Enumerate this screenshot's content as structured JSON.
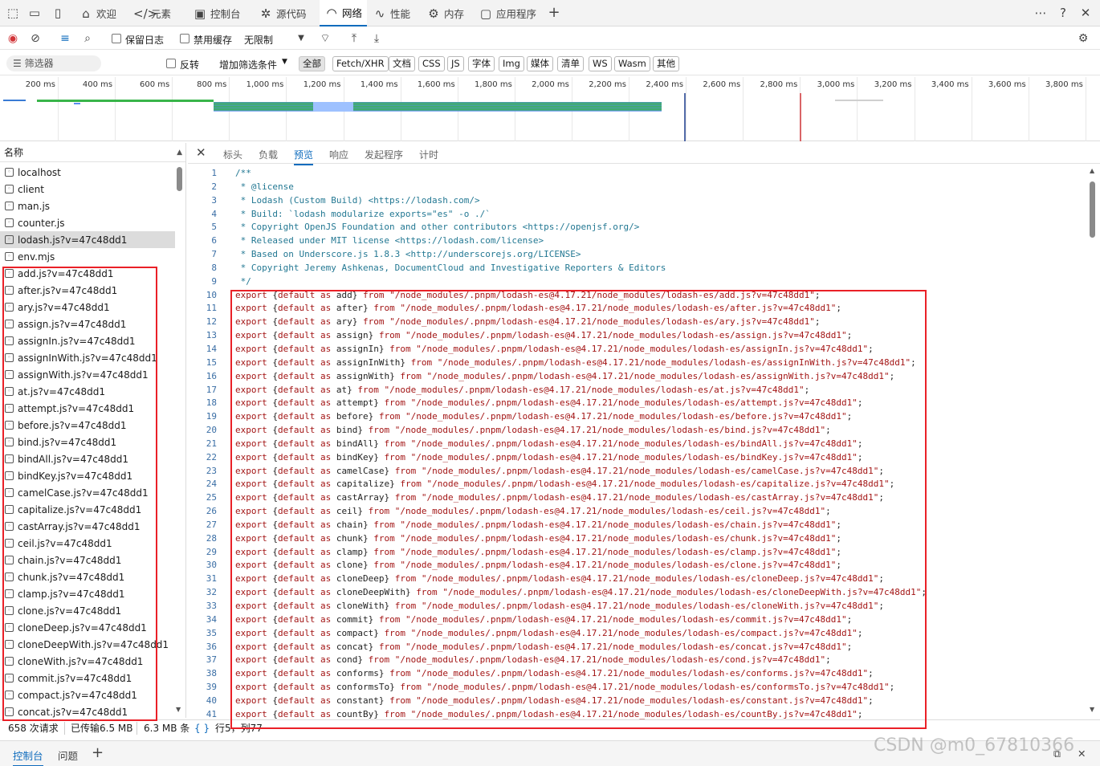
{
  "tabs": [
    {
      "label": "欢迎",
      "icon": "home-icon"
    },
    {
      "label": "元素",
      "icon": "code-icon"
    },
    {
      "label": "控制台",
      "icon": "console-icon"
    },
    {
      "label": "源代码",
      "icon": "bug-icon"
    },
    {
      "label": "网络",
      "icon": "wifi-icon",
      "active": true
    },
    {
      "label": "性能",
      "icon": "performance-icon"
    },
    {
      "label": "内存",
      "icon": "memory-icon"
    },
    {
      "label": "应用程序",
      "icon": "application-icon"
    }
  ],
  "toolbar": {
    "preserve_log": "保留日志",
    "disable_cache": "禁用缓存",
    "throttling": "无限制"
  },
  "filter": {
    "placeholder": "筛选器",
    "invert": "反转",
    "more_filters": "增加筛选条件",
    "types": [
      "全部",
      "Fetch/XHR",
      "文档",
      "CSS",
      "JS",
      "字体",
      "Img",
      "媒体",
      "清单",
      "WS",
      "Wasm",
      "其他"
    ]
  },
  "timeline": {
    "ticks": [
      "200 ms",
      "400 ms",
      "600 ms",
      "800 ms",
      "1,000 ms",
      "1,200 ms",
      "1,400 ms",
      "1,600 ms",
      "1,800 ms",
      "2,000 ms",
      "2,200 ms",
      "2,400 ms",
      "2,600 ms",
      "2,800 ms",
      "3,000 ms",
      "3,200 ms",
      "3,400 ms",
      "3,600 ms",
      "3,800 ms"
    ]
  },
  "requests": {
    "column_name": "名称",
    "items": [
      "localhost",
      "client",
      "man.js",
      "counter.js",
      "lodash.js?v=47c48dd1",
      "env.mjs",
      "add.js?v=47c48dd1",
      "after.js?v=47c48dd1",
      "ary.js?v=47c48dd1",
      "assign.js?v=47c48dd1",
      "assignIn.js?v=47c48dd1",
      "assignInWith.js?v=47c48dd1",
      "assignWith.js?v=47c48dd1",
      "at.js?v=47c48dd1",
      "attempt.js?v=47c48dd1",
      "before.js?v=47c48dd1",
      "bind.js?v=47c48dd1",
      "bindAll.js?v=47c48dd1",
      "bindKey.js?v=47c48dd1",
      "camelCase.js?v=47c48dd1",
      "capitalize.js?v=47c48dd1",
      "castArray.js?v=47c48dd1",
      "ceil.js?v=47c48dd1",
      "chain.js?v=47c48dd1",
      "chunk.js?v=47c48dd1",
      "clamp.js?v=47c48dd1",
      "clone.js?v=47c48dd1",
      "cloneDeep.js?v=47c48dd1",
      "cloneDeepWith.js?v=47c48dd1",
      "cloneWith.js?v=47c48dd1",
      "commit.js?v=47c48dd1",
      "compact.js?v=47c48dd1",
      "concat.js?v=47c48dd1"
    ],
    "selected": "lodash.js?v=47c48dd1"
  },
  "detail_tabs": [
    "标头",
    "负载",
    "预览",
    "响应",
    "发起程序",
    "计时"
  ],
  "detail_active": "预览",
  "code": {
    "header": [
      "/**",
      " * @license",
      " * Lodash (Custom Build) <https://lodash.com/>",
      " * Build: `lodash modularize exports=\"es\" -o ./`",
      " * Copyright OpenJS Foundation and other contributors <https://openjsf.org/>",
      " * Released under MIT license <https://lodash.com/license>",
      " * Based on Underscore.js 1.8.3 <http://underscorejs.org/LICENSE>",
      " * Copyright Jeremy Ashkenas, DocumentCloud and Investigative Reporters & Editors",
      " */"
    ],
    "exports": [
      "add",
      "after",
      "ary",
      "assign",
      "assignIn",
      "assignInWith",
      "assignWith",
      "at",
      "attempt",
      "before",
      "bind",
      "bindAll",
      "bindKey",
      "camelCase",
      "capitalize",
      "castArray",
      "ceil",
      "chain",
      "chunk",
      "clamp",
      "clone",
      "cloneDeep",
      "cloneDeepWith",
      "cloneWith",
      "commit",
      "compact",
      "concat",
      "cond",
      "conforms",
      "conformsTo",
      "constant",
      "countBy"
    ],
    "path_prefix": "/node_modules/.pnpm/lodash-es@4.17.21/node_modules/lodash-es/",
    "path_suffix": ".js?v=47c48dd1"
  },
  "status": {
    "requests": "658 次请求",
    "transferred": "已传输6.5 MB",
    "resources": "6.3 MB 条",
    "position": "行5，列77",
    "braces": "{ }"
  },
  "drawer": {
    "tabs": [
      "控制台",
      "问题"
    ],
    "add": "+"
  },
  "watermark": "CSDN @m0_67810366",
  "colors": {
    "accent": "#0f6cbd",
    "highlight_box": "#ea2027",
    "string": "#a31515",
    "comment": "#237893"
  }
}
